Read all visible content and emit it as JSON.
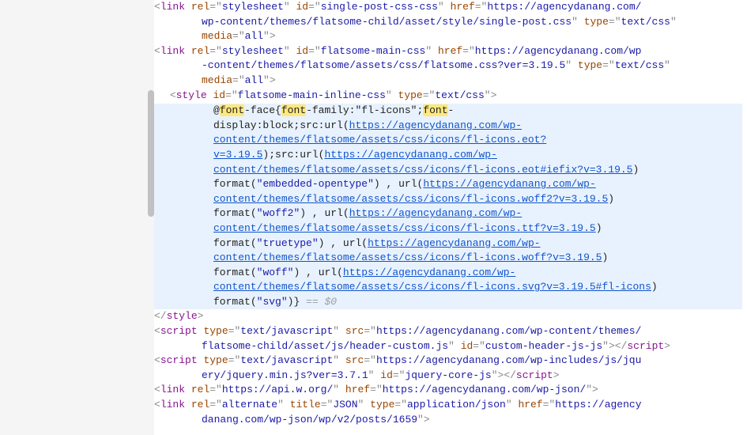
{
  "links": [
    {
      "rel": "stylesheet",
      "id": "single-post-css-css",
      "href_a": "https://agencydanang.com/",
      "href_b": "wp-content/themes/flatsome-child/asset/style/single-post.css",
      "type": "text/css",
      "media": "all"
    },
    {
      "rel": "stylesheet",
      "id": "flatsome-main-css",
      "href_a": "https://agencydanang.com/wp",
      "href_b": "-content/themes/flatsome/assets/css/flatsome.css?ver=3.19.5",
      "type": "text/css",
      "media": "all"
    }
  ],
  "style_open": {
    "tag": "style",
    "id": "flatsome-main-inline-css",
    "type": "text/css"
  },
  "ff": {
    "at": "@",
    "font1": "font",
    "face": "-face{",
    "font2": "font",
    "family": "-family:\"fl-icons\";",
    "font3": "font",
    "dash": "-",
    "display": "display:block;src:url(",
    "u1": "https://agencydanang.com/wp-content/themes/flatsome/assets/css/icons/fl-icons.eot?v=3.19.5",
    "p1": ");src:",
    "urlw": "url",
    "lp": "(",
    "u2": "https://agencydanang.com/wp-content/themes/flatsome/assets/css/icons/fl-icons.eot#iefix?v=3.19.5",
    "rp": ")",
    "fmt": "format",
    "q": "\"",
    "eo": "embedded-opentype",
    "w2": "woff2",
    "tt": "truetype",
    "wf": "woff",
    "sv": "svg",
    "comma": " , ",
    "u3": "https://agencydanang.com/wp-content/themes/flatsome/assets/css/icons/fl-icons.woff2?v=3.19.5",
    "u4": "https://agencydanang.com/wp-content/themes/flatsome/assets/css/icons/fl-icons.ttf?v=3.19.5",
    "u5": "https://agencydanang.com/wp-content/themes/flatsome/assets/css/icons/fl-icons.woff?v=3.19.5",
    "u6": "https://agencydanang.com/wp-content/themes/flatsome/assets/css/icons/fl-icons.svg?v=3.19.5#fl-icons",
    "end": ")}",
    "eq0": " == $0"
  },
  "style_close": "style",
  "scripts": [
    {
      "type": "text/javascript",
      "src_a": "https://agencydanang.com/wp-content/themes/",
      "src_b": "flatsome-child/asset/js/header-custom.js",
      "id": "custom-header-js-js"
    },
    {
      "type": "text/javascript",
      "src_a": "https://agencydanang.com/wp-includes/js/jqu",
      "src_b": "ery/jquery.min.js?ver=3.7.1",
      "id": "jquery-core-js"
    }
  ],
  "extra_links": [
    {
      "rel": "https://api.w.org/",
      "href": "https://agencydanang.com/wp-json/"
    },
    {
      "rel": "alternate",
      "title": "JSON",
      "type": "application/json",
      "href_a": "https://agency",
      "href_b": "danang.com/wp-json/wp/v2/posts/1659"
    }
  ]
}
